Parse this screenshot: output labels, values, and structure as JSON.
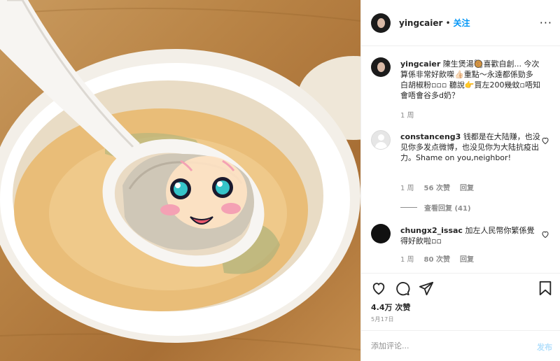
{
  "header": {
    "username": "yingcaier",
    "separator": "•",
    "follow_label": "关注",
    "more_label": "···"
  },
  "caption": {
    "username": "yingcaier",
    "text": "陳生煲湯🥘喜歡自創... 今次算係非常好飲㗎👍🏻重點～永遠都係勁多白胡椒粉▫▫▫ 聽說👉買左200幾蚊▫唔知會唔會谷多d奶？",
    "time": "1 周"
  },
  "comments": [
    {
      "username": "constanceng3",
      "text": "钱都是在大陆赚，也没见你多发点微博，也没见你为大陆抗疫出力。Shame on you,neighbor!",
      "time": "1 周",
      "likes": "56 次赞",
      "reply_label": "回复",
      "view_replies": "查看回复 (41)"
    },
    {
      "username": "chungx2_issac",
      "text": "加左人民幣你繁係覺得好飲啦▫▫",
      "time": "1 周",
      "likes": "80 次赞",
      "reply_label": "回复"
    }
  ],
  "stats": {
    "likes": "4.4万 次赞",
    "date": "5月17日"
  },
  "composer": {
    "placeholder": "添加评论...",
    "post_label": "发布"
  },
  "icons": {
    "like": "heart-icon",
    "comment": "comment-icon",
    "share": "paper-plane-icon",
    "save": "bookmark-icon",
    "comment_like": "heart-icon"
  },
  "colors": {
    "link_blue": "#0095f6",
    "post_disabled": "#b2dffc",
    "meta_gray": "#8e8e8e"
  }
}
